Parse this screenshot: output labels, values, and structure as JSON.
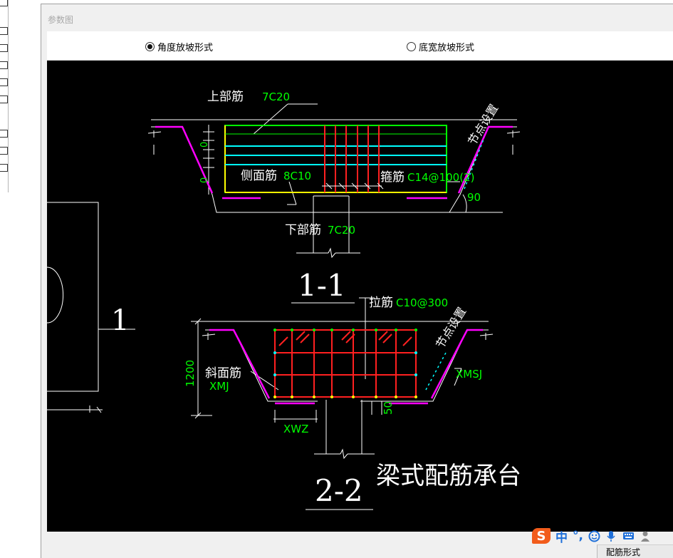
{
  "window": {
    "title": "参数图"
  },
  "options": [
    {
      "label": "角度放坡形式",
      "selected": true
    },
    {
      "label": "底宽放坡形式",
      "selected": false
    }
  ],
  "drawing": {
    "s11": {
      "top_label": "上部筋",
      "top_value": "7C20",
      "side_label": "侧面筋",
      "side_value": "8C10",
      "stirrup_label": "箍筋",
      "stirrup_value": "C14@100(2)",
      "bottom_label": "下部筋",
      "bottom_value": "7C20",
      "node_label": "节点设置",
      "angle": "90",
      "dim_a": "0",
      "dim_b": "0",
      "section": "1-1"
    },
    "s22": {
      "tie_label": "拉筋",
      "tie_value": "C10@300",
      "node_label": "节点设置",
      "slope_label": "斜面筋",
      "slope_value": "XMJ",
      "xmsj": "XMSJ",
      "xwz": "XWZ",
      "height": "1200",
      "dim_50": "50",
      "section": "2-2"
    },
    "plan_label": "1",
    "caption": "梁式配筋承台"
  },
  "ime": {
    "brand": "S",
    "lang": "中",
    "punct": "°,"
  },
  "bottom_button": "配筋形式",
  "colors": {
    "cad_bg": "#000000",
    "rebar_red": "#ff2020",
    "rebar_green": "#00ff00",
    "rebar_cyan": "#00ffff",
    "rebar_yellow": "#ffff00",
    "slope_magenta": "#ff00ff",
    "dim_text_green": "#00ff00"
  }
}
